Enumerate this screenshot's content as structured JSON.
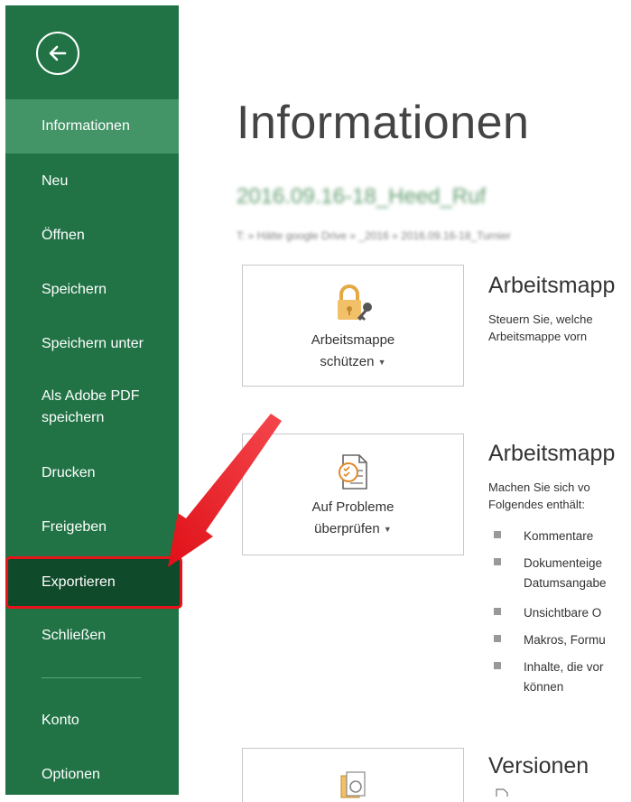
{
  "sidebar": {
    "items": [
      {
        "label": "Informationen"
      },
      {
        "label": "Neu"
      },
      {
        "label": "Öffnen"
      },
      {
        "label": "Speichern"
      },
      {
        "label": "Speichern unter"
      },
      {
        "label": "Als Adobe PDF\nspeichern"
      },
      {
        "label": "Drucken"
      },
      {
        "label": "Freigeben"
      },
      {
        "label": "Exportieren"
      },
      {
        "label": "Schließen"
      },
      {
        "label": "Konto"
      },
      {
        "label": "Optionen"
      }
    ]
  },
  "main": {
    "title": "Informationen",
    "file_name": "2016.09.16-18_Heed_Ruf",
    "file_path": "T: » Hätte google Drive » _2016 » 2016.09.16-18_Turnier",
    "protect": {
      "tile_line1": "Arbeitsmappe",
      "tile_line2": "schützen",
      "title": "Arbeitsmapp",
      "desc_line1": "Steuern Sie, welche",
      "desc_line2": "Arbeitsmappe vorn"
    },
    "inspect": {
      "tile_line1": "Auf Probleme",
      "tile_line2": "überprüfen",
      "title": "Arbeitsmapp",
      "desc_line1": "Machen Sie sich vo",
      "desc_line2": "Folgendes enthält:",
      "bullets": [
        {
          "line1": "Kommentare",
          "line2": ""
        },
        {
          "line1": "Dokumenteige",
          "line2": "Datumsangabe"
        },
        {
          "line1": "Unsichtbare O",
          "line2": ""
        },
        {
          "line1": "Makros, Formu",
          "line2": ""
        },
        {
          "line1": "Inhalte, die vor",
          "line2": "können"
        }
      ]
    },
    "versions": {
      "title": "Versionen"
    }
  },
  "colors": {
    "sidebar_bg": "#217346",
    "sidebar_active": "#439467",
    "highlight": "#e8121a"
  }
}
